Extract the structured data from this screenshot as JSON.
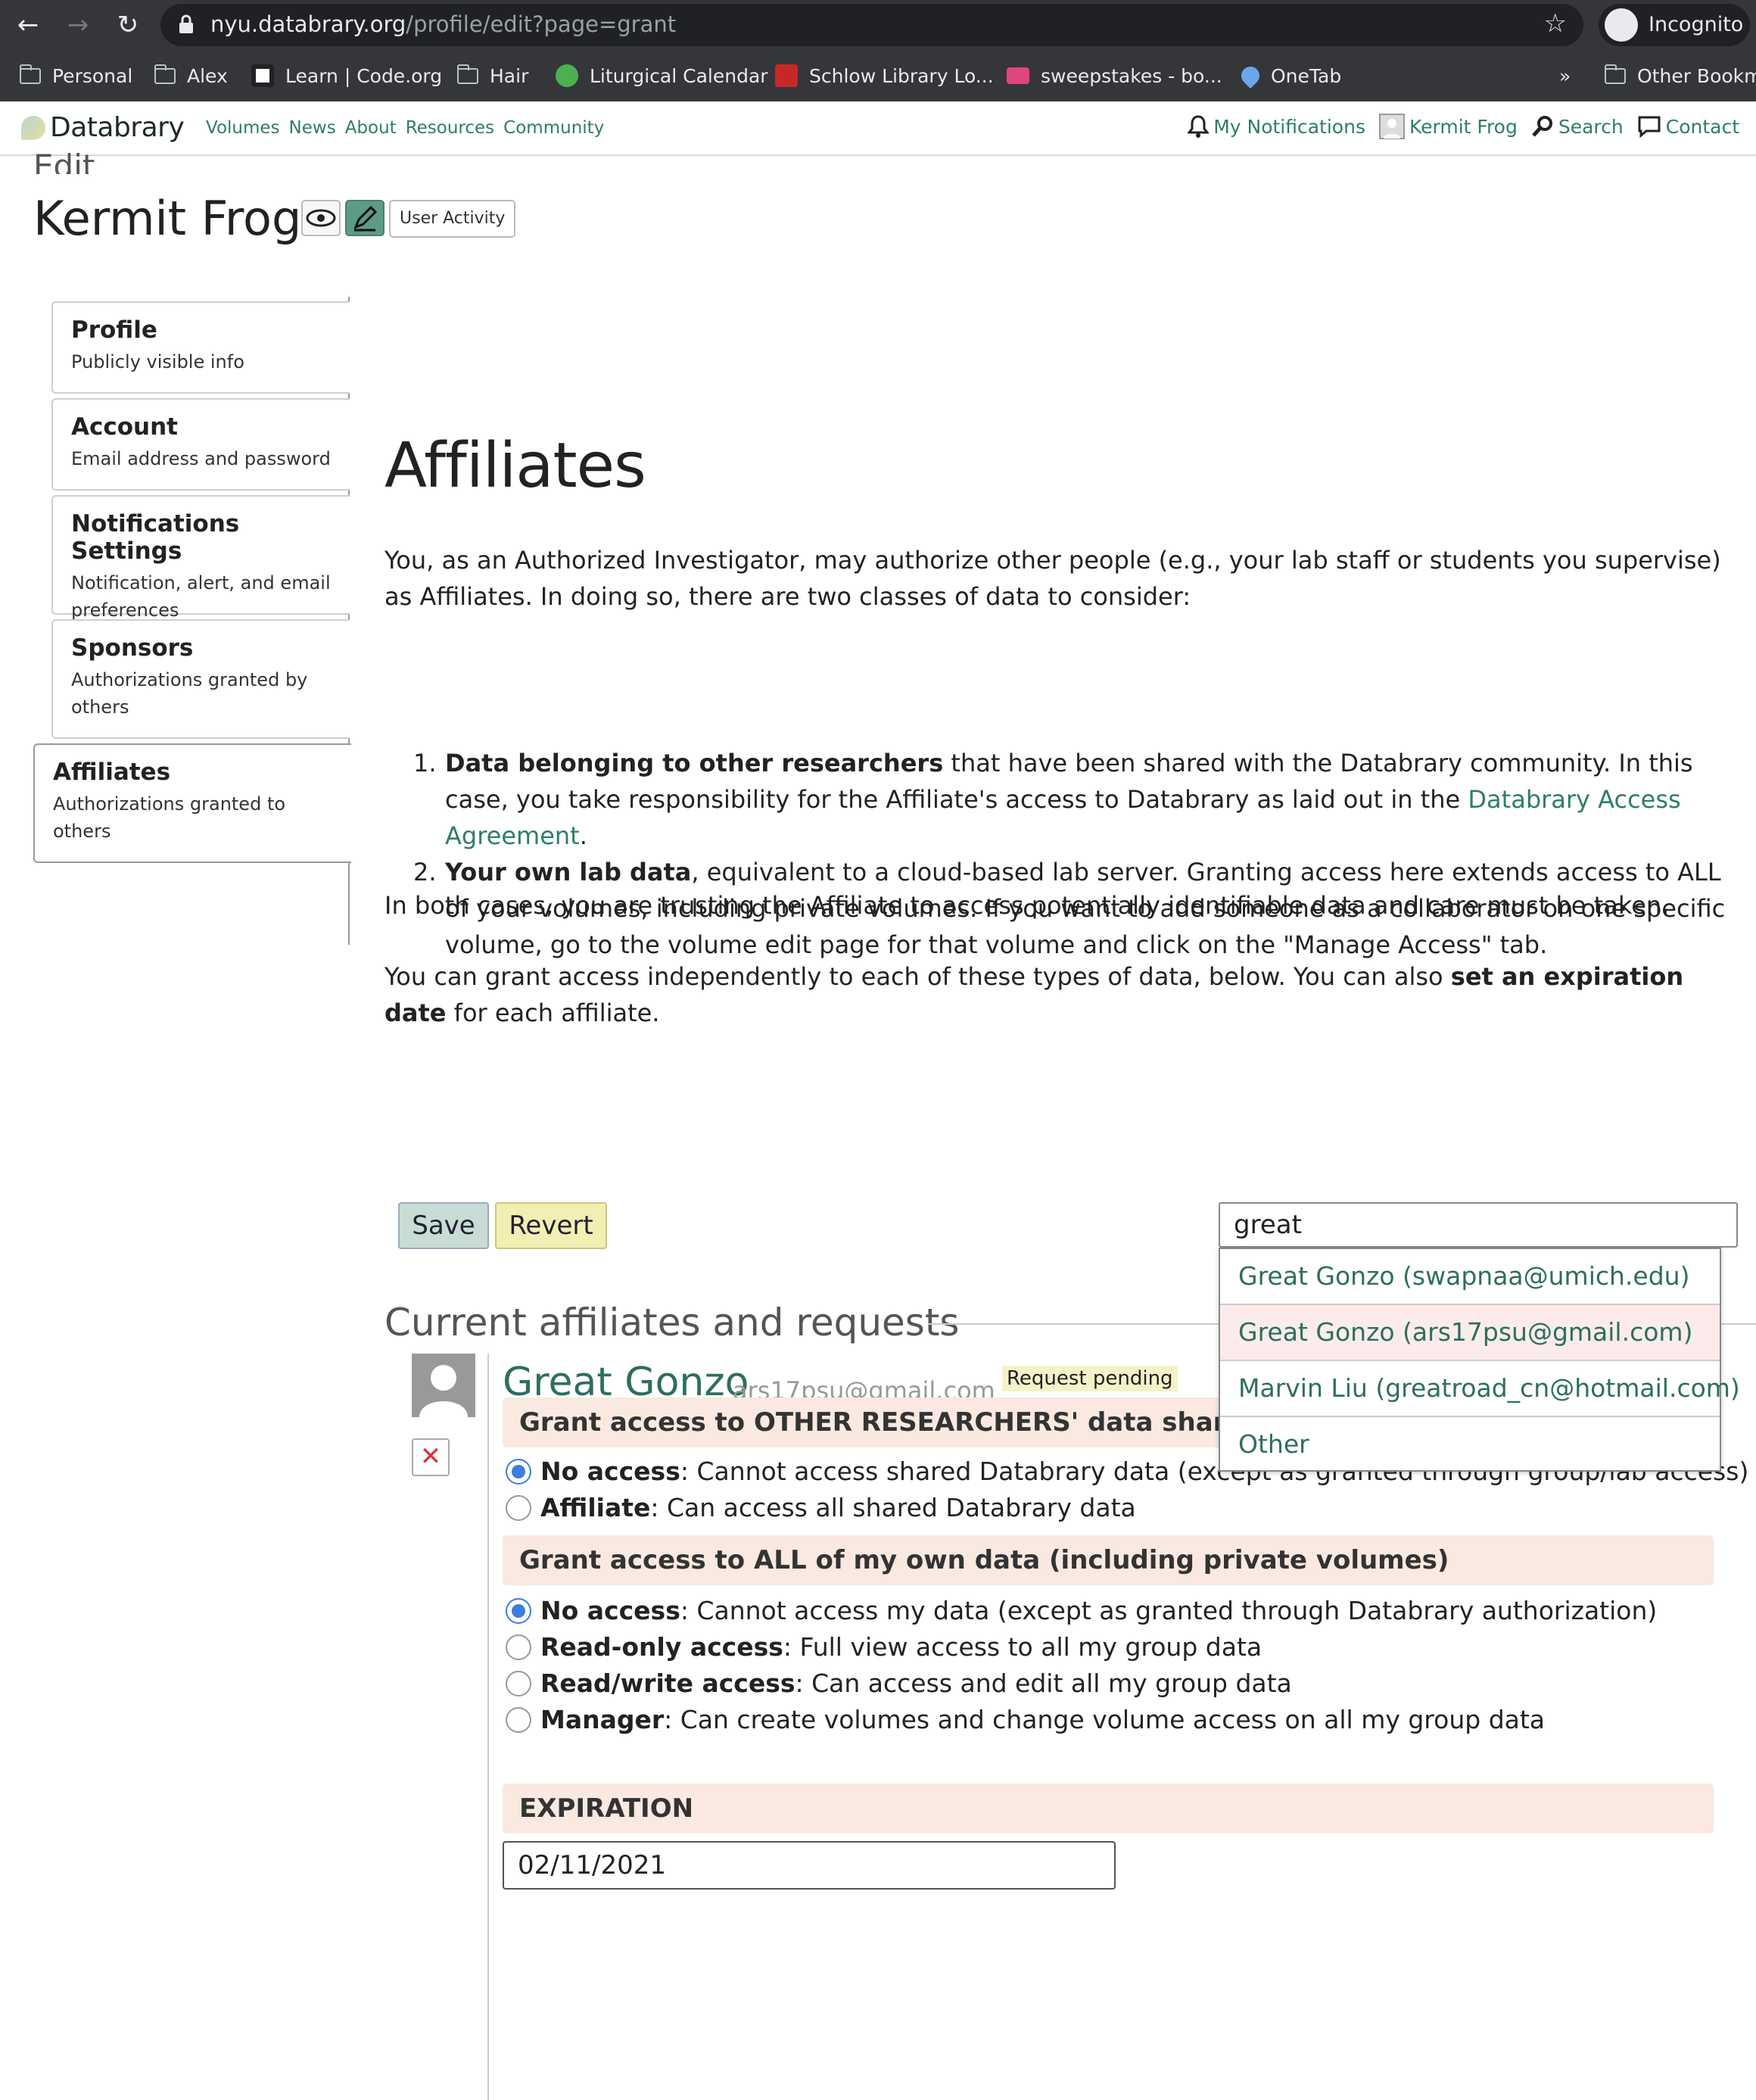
{
  "browser": {
    "url_host": "nyu.databrary.org",
    "url_path": "/profile/edit?page=grant",
    "incognito_label": "Incognito",
    "bookmarks": [
      "Personal",
      "Alex",
      "Learn | Code.org",
      "Hair",
      "Liturgical Calendar",
      "Schlow Library Lo...",
      "sweepstakes - bo...",
      "OneTab"
    ],
    "more": "»",
    "other_bookmarks": "Other Bookma"
  },
  "site": {
    "logo": "Databrary",
    "nav": [
      "Volumes",
      "News",
      "About",
      "Resources",
      "Community"
    ],
    "right_nav": {
      "notifications": "My Notifications",
      "user": "Kermit Frog",
      "search": "Search",
      "contact": "Contact"
    }
  },
  "page": {
    "edit_label": "Edit",
    "profile_name": "Kermit Frog",
    "user_activity": "User Activity"
  },
  "sidebar": [
    {
      "title": "Profile",
      "subtitle": "Publicly visible info"
    },
    {
      "title": "Account",
      "subtitle": "Email address and password"
    },
    {
      "title": "Notifications Settings",
      "subtitle": "Notification, alert, and email preferences"
    },
    {
      "title": "Sponsors",
      "subtitle": "Authorizations granted by others"
    },
    {
      "title": "Affiliates",
      "subtitle": "Authorizations granted to others"
    }
  ],
  "main": {
    "heading": "Affiliates",
    "intro": "You, as an Authorized Investigator, may authorize other people (e.g., your lab staff or students you supervise) as Affiliates. In doing so, there are two classes of data to consider:",
    "list": [
      {
        "num": "1.",
        "bold": "Data belonging to other researchers",
        "text1": " that have been shared with the Databrary community. In this case, you take responsibility for the Affiliate's access to Databrary as laid out in the ",
        "link": "Databrary Access Agreement",
        "text2": "."
      },
      {
        "num": "2.",
        "bold": "Your own lab data",
        "text1": ", equivalent to a cloud-based lab server. Granting access here extends access to ALL of your volumes, including private volumes. If you want to add someone as a collaborator on one specific volume, go to the volume edit page for that volume and click on the \"Manage Access\" tab."
      }
    ],
    "trust": "In both cases, you are trusting the Affiliate to access potentially identifiable data and care must be taken.",
    "grant_a": "You can grant access independently to each of these types of data, below. You can also ",
    "grant_bold": "set an expiration date",
    "grant_b": " for each affiliate.",
    "save": "Save",
    "revert": "Revert",
    "search_value": "great",
    "dropdown": [
      "Great Gonzo (swapnaa@umich.edu)",
      "Great Gonzo (ars17psu@gmail.com)",
      "Marvin Liu (greatroad_cn@hotmail.com)",
      "Other"
    ],
    "section_title": "Current affiliates and requests",
    "affiliate": {
      "name": "Great Gonzo",
      "email": "ars17psu@gmail.com",
      "status": "Request pending",
      "remove": "✕",
      "others_heading": "Grant access to OTHER RESEARCHERS' data shared on Databrary",
      "others_options": [
        {
          "bold": "No access",
          "text": ": Cannot access shared Databrary data (except as granted through group/lab access)",
          "checked": true
        },
        {
          "bold": "Affiliate",
          "text": ": Can access all shared Databrary data",
          "checked": false
        }
      ],
      "own_heading": "Grant access to ALL of my own data (including private volumes)",
      "own_options": [
        {
          "bold": "No access",
          "text": ": Cannot access my data (except as granted through Databrary authorization)",
          "checked": true
        },
        {
          "bold": "Read-only access",
          "text": ": Full view access to all my group data",
          "checked": false
        },
        {
          "bold": "Read/write access",
          "text": ": Can access and edit all my group data",
          "checked": false
        },
        {
          "bold": "Manager",
          "text": ": Can create volumes and change volume access on all my group data",
          "checked": false
        }
      ],
      "expiration_heading": "EXPIRATION",
      "expiration_value": "02/11/2021"
    }
  },
  "colors": {
    "accent": "#2e7d6a",
    "band": "#f9e9e0",
    "radio": "#3b7de0"
  }
}
